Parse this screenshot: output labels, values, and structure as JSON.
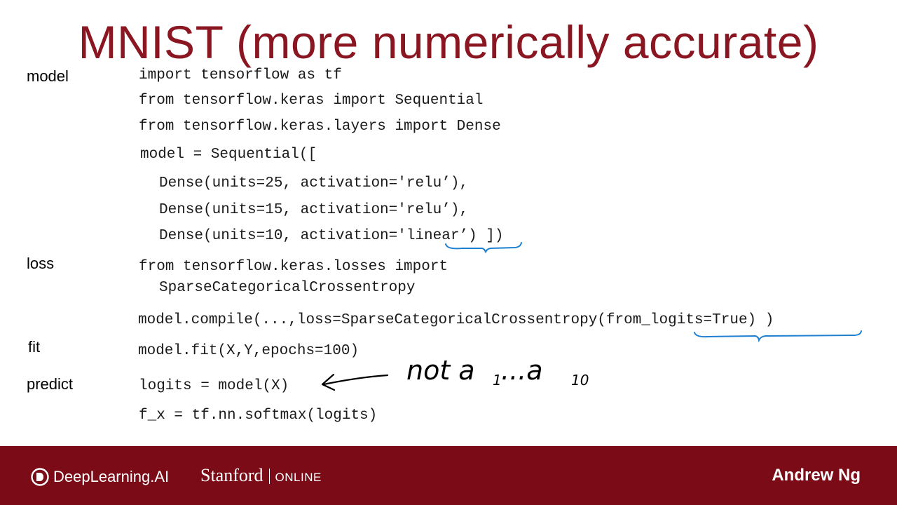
{
  "title": "MNIST (more numerically accurate)",
  "sections": {
    "model": "model",
    "loss": "loss",
    "fit": "fit",
    "predict": "predict"
  },
  "code": {
    "line1": "import tensorflow as tf",
    "line2": "from tensorflow.keras import Sequential",
    "line3": "from tensorflow.keras.layers import Dense",
    "line4": "model = Sequential([",
    "line5": "Dense(units=25, activation='relu’),",
    "line6": "Dense(units=15, activation='relu’),",
    "line7": "Dense(units=10, activation='linear’) ])",
    "loss1": "from tensorflow.keras.losses import",
    "loss2": "SparseCategoricalCrossentropy",
    "compile": "model.compile(...,loss=SparseCategoricalCrossentropy(from_logits=True) )",
    "fit": "model.fit(X,Y,epochs=100)",
    "predict1": "logits = model(X)",
    "predict2": "f_x = tf.nn.softmax(logits)"
  },
  "handwritten_note": {
    "prefix": "not a",
    "sub1": "1",
    "middle": "...a",
    "sub2": "10"
  },
  "footer": {
    "deeplearning_logo": "DeepLearning.AI",
    "stanford": "Stanford",
    "online": "ONLINE",
    "presenter": "Andrew Ng"
  },
  "colors": {
    "title": "#8a1622",
    "footer_bg": "#7b0c17",
    "annotation_blue": "#1f7fd0"
  }
}
